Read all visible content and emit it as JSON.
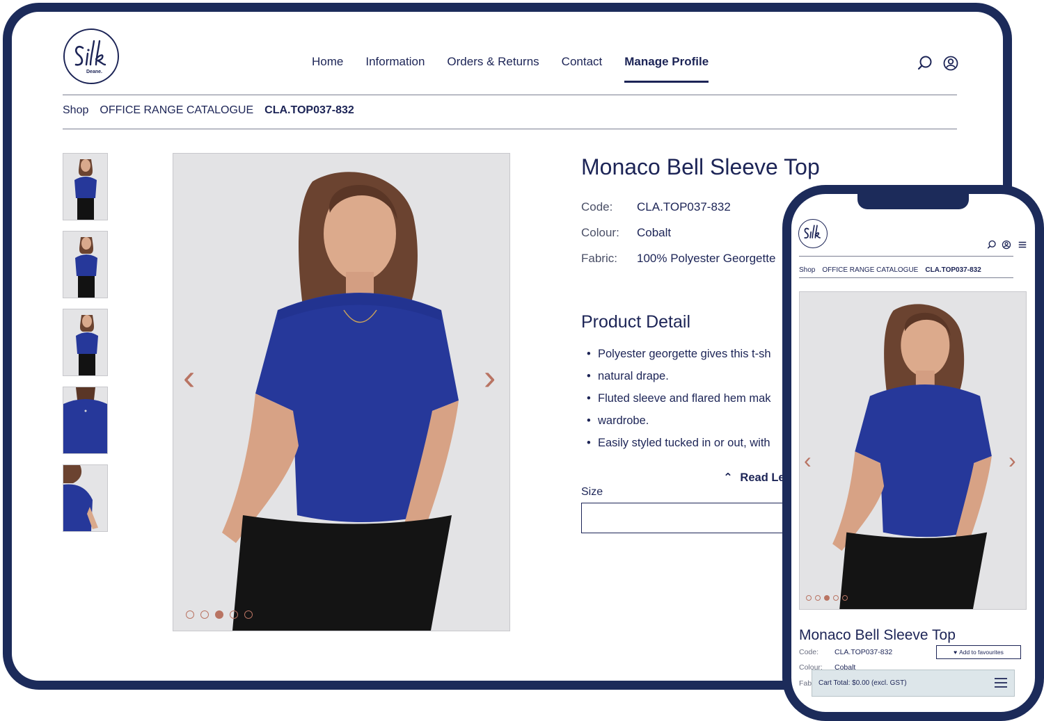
{
  "brand": {
    "logo_text": "Silk",
    "logo_sub": "Deane."
  },
  "nav": {
    "items": [
      "Home",
      "Information",
      "Orders & Returns",
      "Contact",
      "Manage Profile"
    ],
    "active": "Manage Profile"
  },
  "breadcrumb": {
    "shop": "Shop",
    "category": "OFFICE RANGE CATALOGUE",
    "current": "CLA.TOP037-832"
  },
  "product": {
    "title": "Monaco Bell Sleeve Top",
    "code_label": "Code:",
    "code": "CLA.TOP037-832",
    "colour_label": "Colour:",
    "colour": "Cobalt",
    "fabric_label": "Fabric:",
    "fabric": "100% Polyester Georgette"
  },
  "detail": {
    "heading": "Product Detail",
    "bullets": [
      "Polyester georgette gives this t-sh",
      "natural drape.",
      "Fluted sleeve and flared hem mak",
      "wardrobe.",
      "Easily styled tucked in or out, with"
    ],
    "read_less": "Read Le"
  },
  "size": {
    "label": "Size"
  },
  "gallery": {
    "image_count": 5,
    "active_index": 2,
    "prev_icon": "chevron-left-icon",
    "next_icon": "chevron-right-icon"
  },
  "mobile": {
    "breadcrumb": {
      "shop": "Shop",
      "category": "OFFICE RANGE CATALOGUE",
      "current": "CLA.TOP037-832"
    },
    "title": "Monaco Bell Sleeve Top",
    "code_label": "Code:",
    "code": "CLA.TOP037-832",
    "colour_label": "Colour:",
    "colour": "Cobalt",
    "fabric_label": "Fab",
    "favourites": "Add to favourites",
    "cart": "Cart Total: $0.00 (excl. GST)",
    "gallery": {
      "image_count": 5,
      "active_index": 2
    }
  },
  "colors": {
    "navy": "#1c2456",
    "frame": "#1c2b5a",
    "accent": "#b97463",
    "product": "#26389a",
    "cart_bar": "#dde6ea"
  }
}
